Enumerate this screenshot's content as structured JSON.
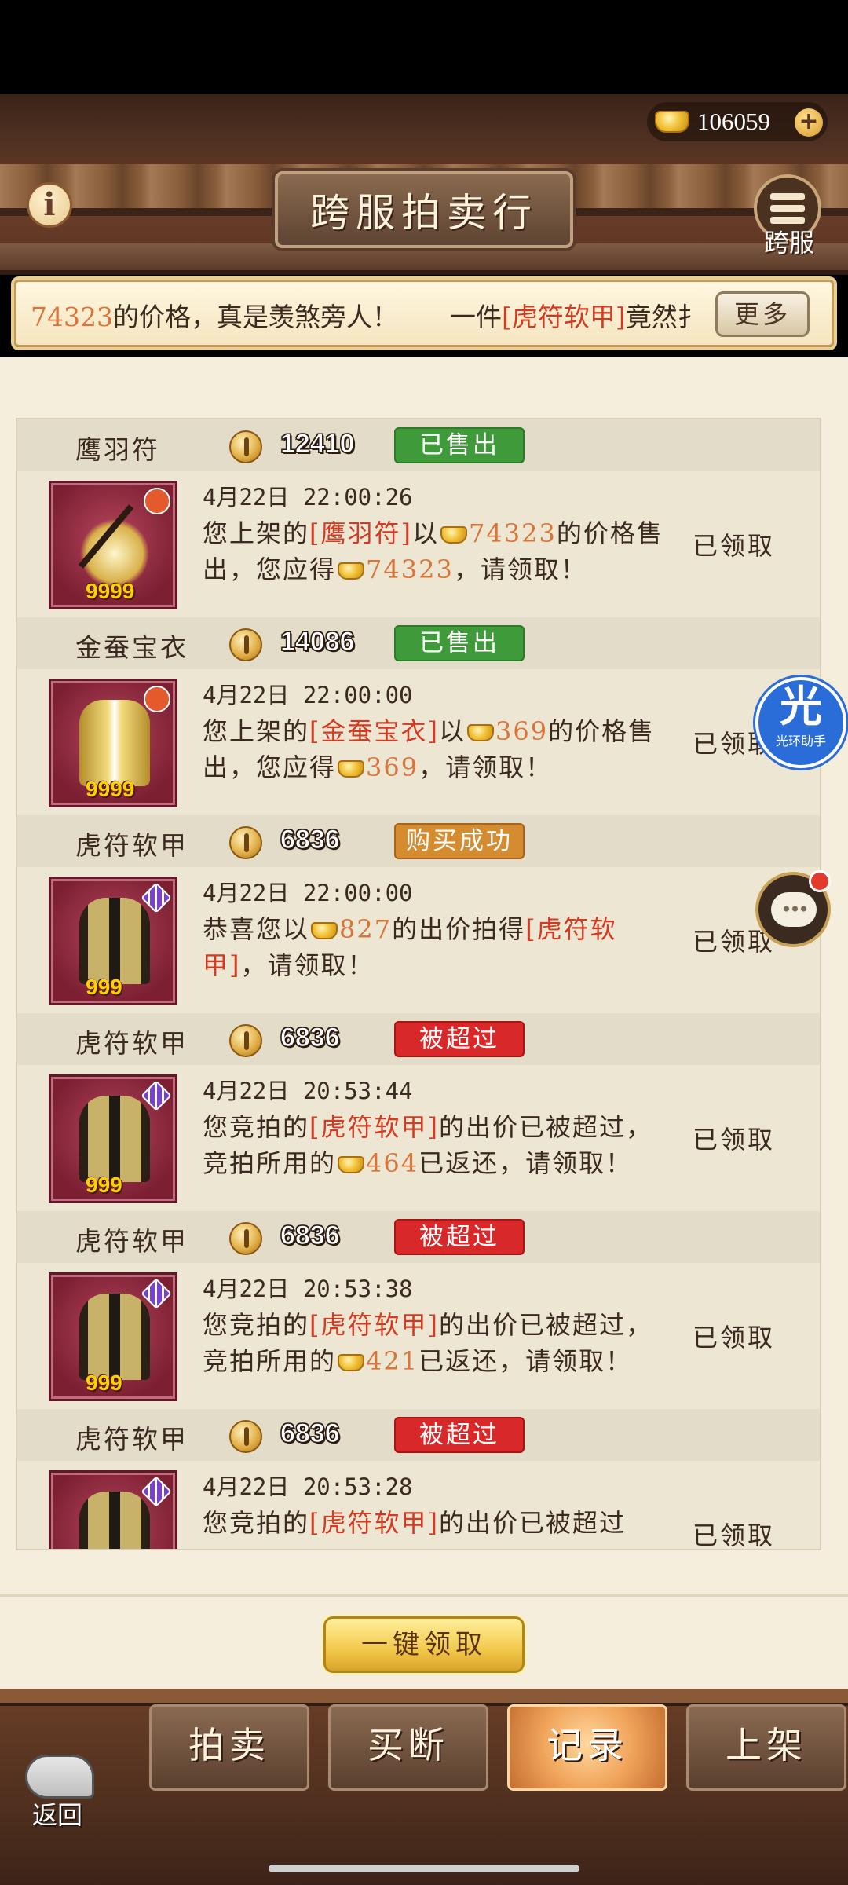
{
  "header": {
    "title": "跨服拍卖行",
    "currency_value": "106059",
    "cross_server_label": "跨服",
    "info_glyph": "i"
  },
  "ticker": {
    "part1": "74323",
    "part2": "的价格，真是羡煞旁人！",
    "part3": "一件",
    "part4": "[虎符软甲]",
    "part5": "竟然扌",
    "more_label": "更多"
  },
  "records": [
    {
      "name": "鹰羽符",
      "price": "12410",
      "status": "已售出",
      "quantity": "9999",
      "time": "4月22日 22:00:26",
      "msg_a": "您上架的",
      "msg_item": "[鹰羽符]",
      "msg_b": "以",
      "msg_amount1": "74323",
      "msg_c": "的价格售出，您应得",
      "msg_amount2": "74323",
      "msg_d": "，请领取！",
      "claim": "已领取"
    },
    {
      "name": "金蚕宝衣",
      "price": "14086",
      "status": "已售出",
      "quantity": "9999",
      "time": "4月22日 22:00:00",
      "msg_a": "您上架的",
      "msg_item": "[金蚕宝衣]",
      "msg_b": "以",
      "msg_amount1": "369",
      "msg_c": "的价格售出，您应得",
      "msg_amount2": "369",
      "msg_d": "，请领取！",
      "claim": "已领取"
    },
    {
      "name": "虎符软甲",
      "price": "6836",
      "status": "购买成功",
      "quantity": "999",
      "time": "4月22日 22:00:00",
      "msg_a": "恭喜您以",
      "msg_amount1": "827",
      "msg_b": "的出价拍得",
      "msg_item": "[虎符软甲]",
      "msg_c": "，请领取！",
      "claim": "已领取"
    },
    {
      "name": "虎符软甲",
      "price": "6836",
      "status": "被超过",
      "quantity": "999",
      "time": "4月22日 20:53:44",
      "msg_a": "您竞拍的",
      "msg_item": "[虎符软甲]",
      "msg_b": "的出价已被超过，竞拍所用的",
      "msg_amount1": "464",
      "msg_c": "已返还，请领取！",
      "claim": "已领取"
    },
    {
      "name": "虎符软甲",
      "price": "6836",
      "status": "被超过",
      "quantity": "999",
      "time": "4月22日 20:53:38",
      "msg_a": "您竞拍的",
      "msg_item": "[虎符软甲]",
      "msg_b": "的出价已被超过，竞拍所用的",
      "msg_amount1": "421",
      "msg_c": "已返还，请领取！",
      "claim": "已领取"
    },
    {
      "name": "虎符软甲",
      "price": "6836",
      "status": "被超过",
      "quantity": "999",
      "time": "4月22日 20:53:28",
      "msg_a": "您竞拍的",
      "msg_item": "[虎符软甲]",
      "msg_b": "的出价已被超过",
      "claim": "已领取"
    }
  ],
  "claim_all_label": "一键领取",
  "nav": {
    "back_label": "返回",
    "tabs": [
      "拍卖",
      "买断",
      "记录",
      "上架"
    ],
    "active_tab": "记录"
  },
  "assistant": {
    "glyph": "光",
    "label": "光环助手"
  },
  "colors": {
    "highlight": "#d43a22",
    "amount": "#d9743a",
    "active_tab": "#f0a45a",
    "sold": "#3f9a3a",
    "bought": "#d58b2f",
    "outbid": "#d8282a"
  },
  "icons": [
    "info-icon",
    "ingot-icon",
    "plus-icon",
    "menu-icon",
    "coin-icon",
    "back-arrow-icon",
    "chat-icon"
  ]
}
